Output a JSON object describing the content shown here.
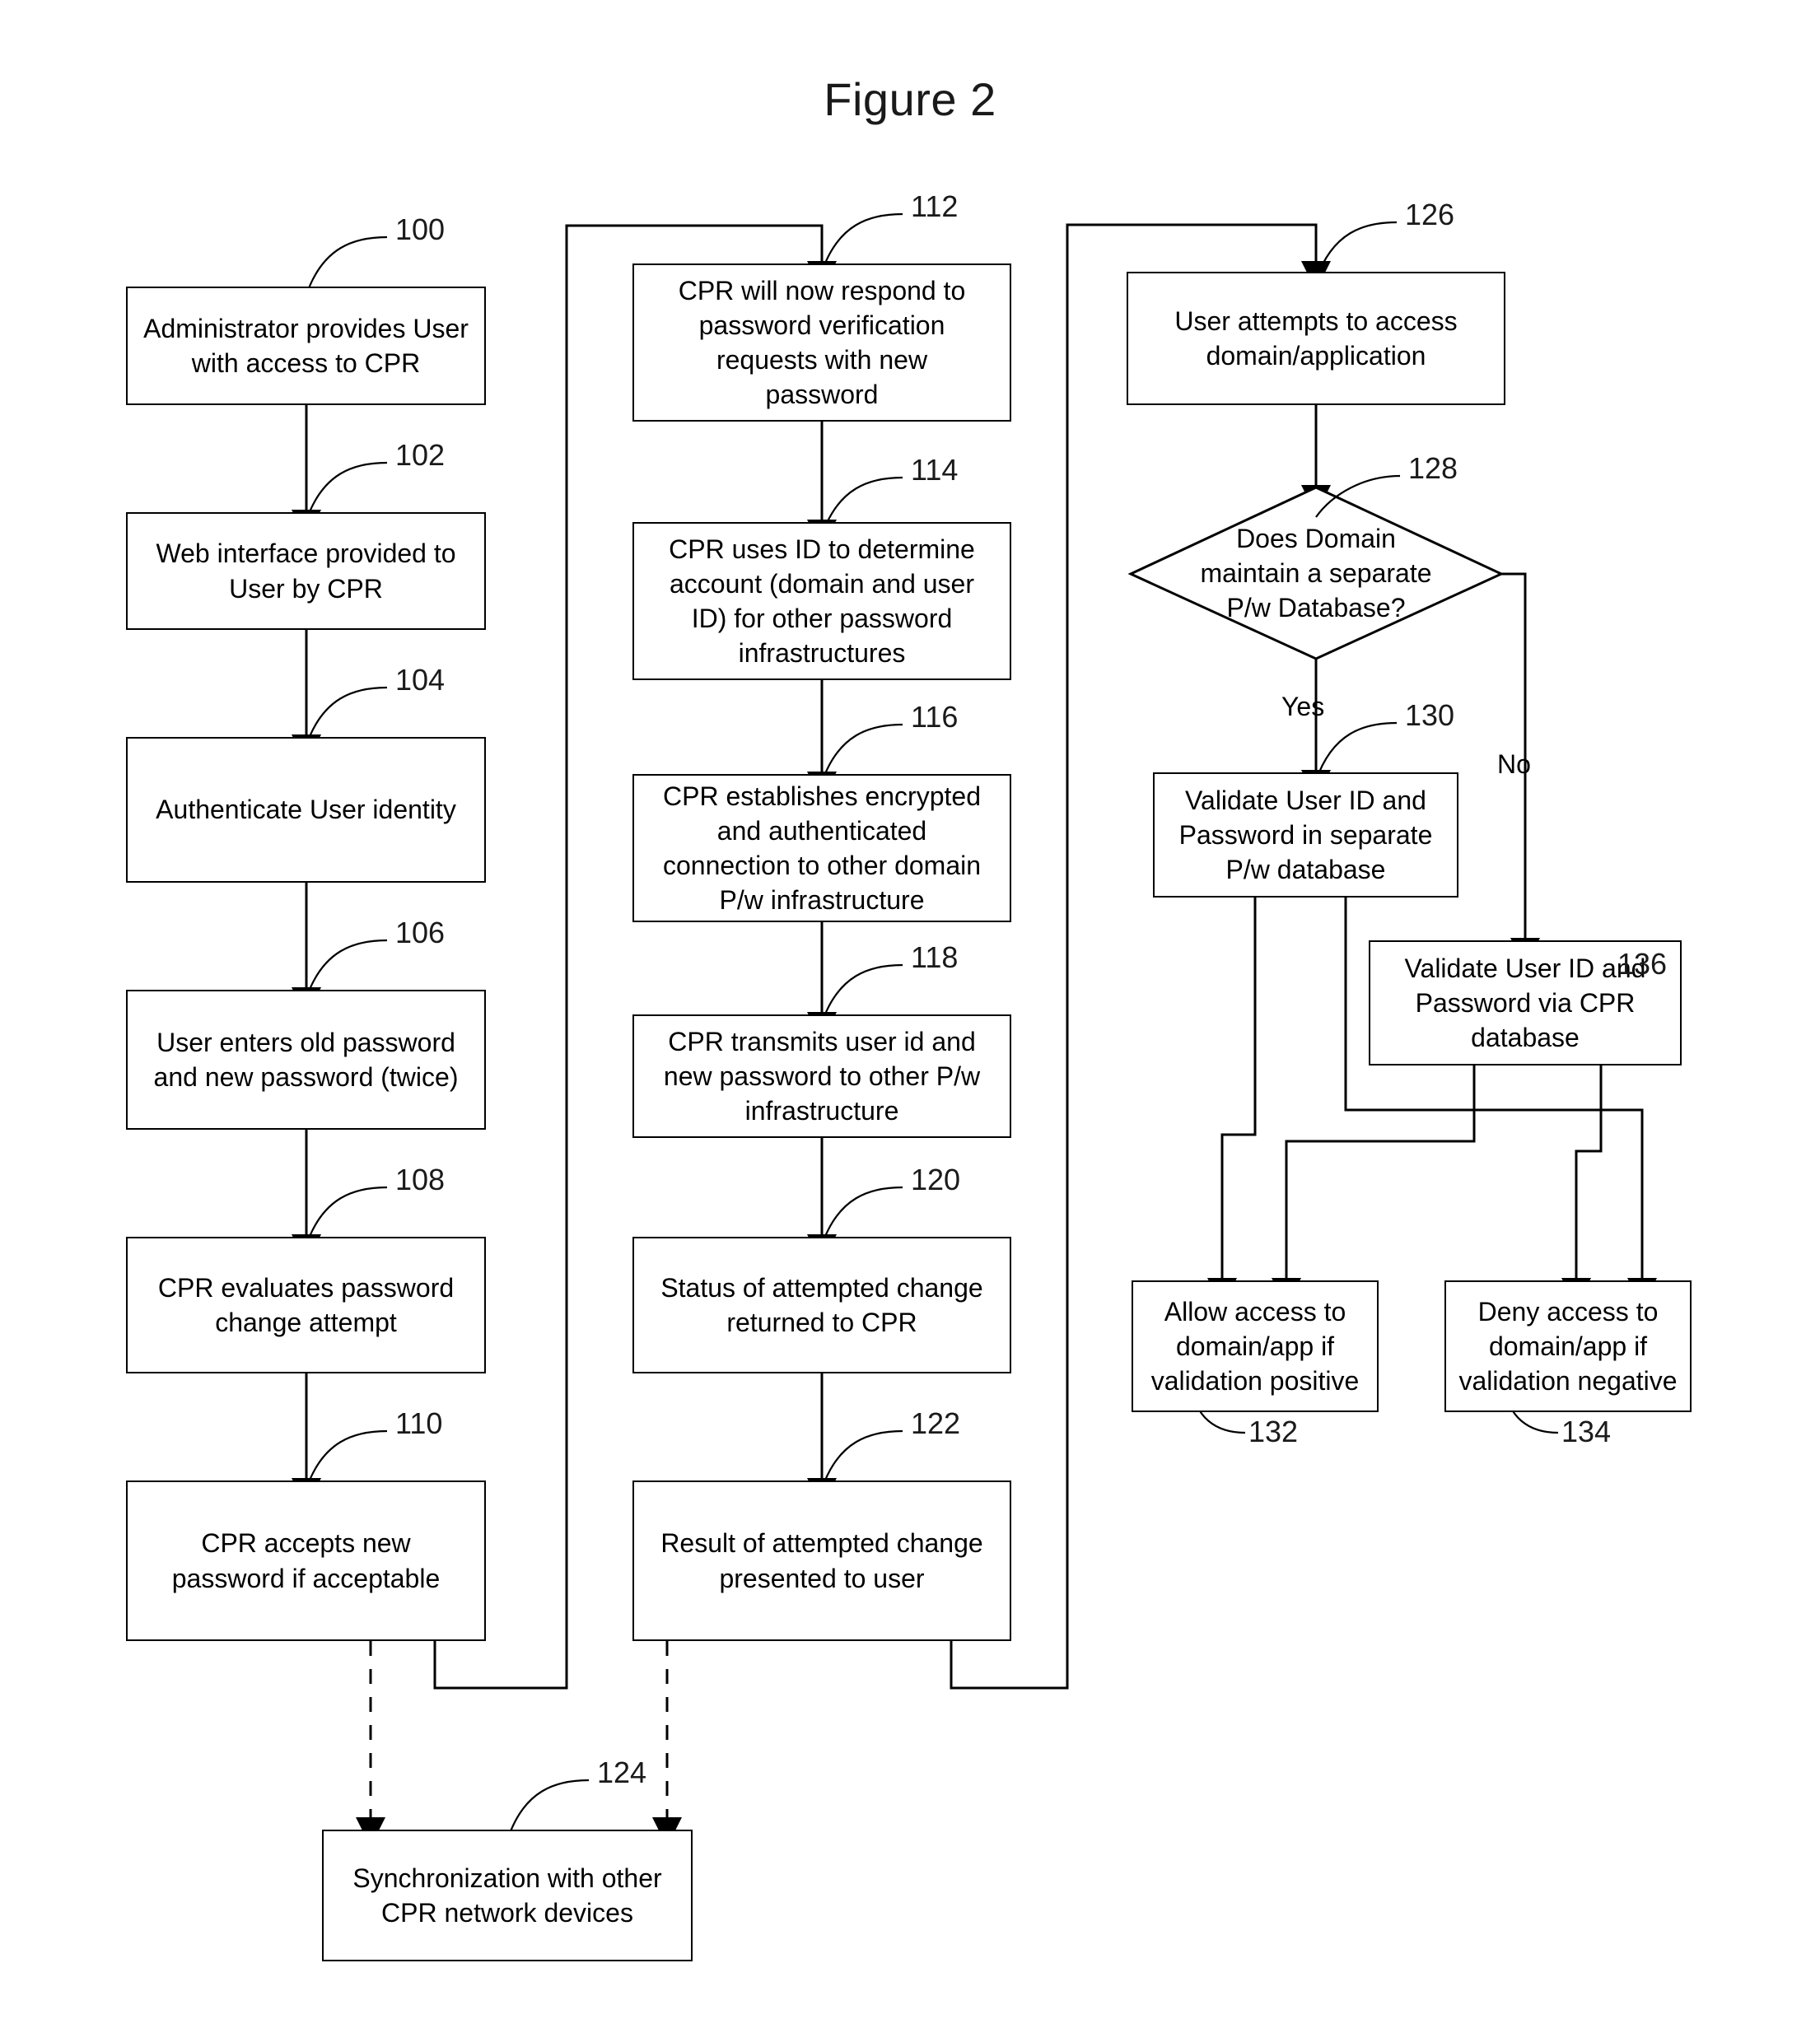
{
  "figure": {
    "title": "Figure 2"
  },
  "nodes": [
    {
      "ref": "100",
      "text": "Administrator provides User\nwith access to CPR"
    },
    {
      "ref": "102",
      "text": "Web interface provided to\nUser by CPR"
    },
    {
      "ref": "104",
      "text": "Authenticate User identity"
    },
    {
      "ref": "106",
      "text": "User enters old password\nand new password (twice)"
    },
    {
      "ref": "108",
      "text": "CPR evaluates password\nchange attempt"
    },
    {
      "ref": "110",
      "text": "CPR accepts new\npassword if acceptable"
    },
    {
      "ref": "112",
      "text": "CPR will now respond to\npassword verification\nrequests with new\npassword"
    },
    {
      "ref": "114",
      "text": "CPR uses ID to determine\naccount (domain and user\nID) for other password\ninfrastructures"
    },
    {
      "ref": "116",
      "text": "CPR establishes encrypted\nand authenticated\nconnection to other domain\nP/w infrastructure"
    },
    {
      "ref": "118",
      "text": "CPR transmits user id and\nnew password to other P/w\ninfrastructure"
    },
    {
      "ref": "120",
      "text": "Status of attempted change\nreturned to CPR"
    },
    {
      "ref": "122",
      "text": "Result of attempted change\npresented to user"
    },
    {
      "ref": "124",
      "text": "Synchronization with other\nCPR network devices"
    },
    {
      "ref": "126",
      "text": "User attempts to access\ndomain/application"
    },
    {
      "ref": "128",
      "text": "Does Domain\nmaintain a separate\nP/w Database?"
    },
    {
      "ref": "130",
      "text": "Validate User ID and\nPassword in separate\nP/w database"
    },
    {
      "ref": "132",
      "text": "Allow access to\ndomain/app if\nvalidation positive"
    },
    {
      "ref": "134",
      "text": "Deny access to\ndomain/app if\nvalidation negative"
    },
    {
      "ref": "136",
      "text": "Validate User ID and\nPassword via CPR\ndatabase"
    }
  ],
  "edge_labels": {
    "yes": "Yes",
    "no": "No"
  }
}
